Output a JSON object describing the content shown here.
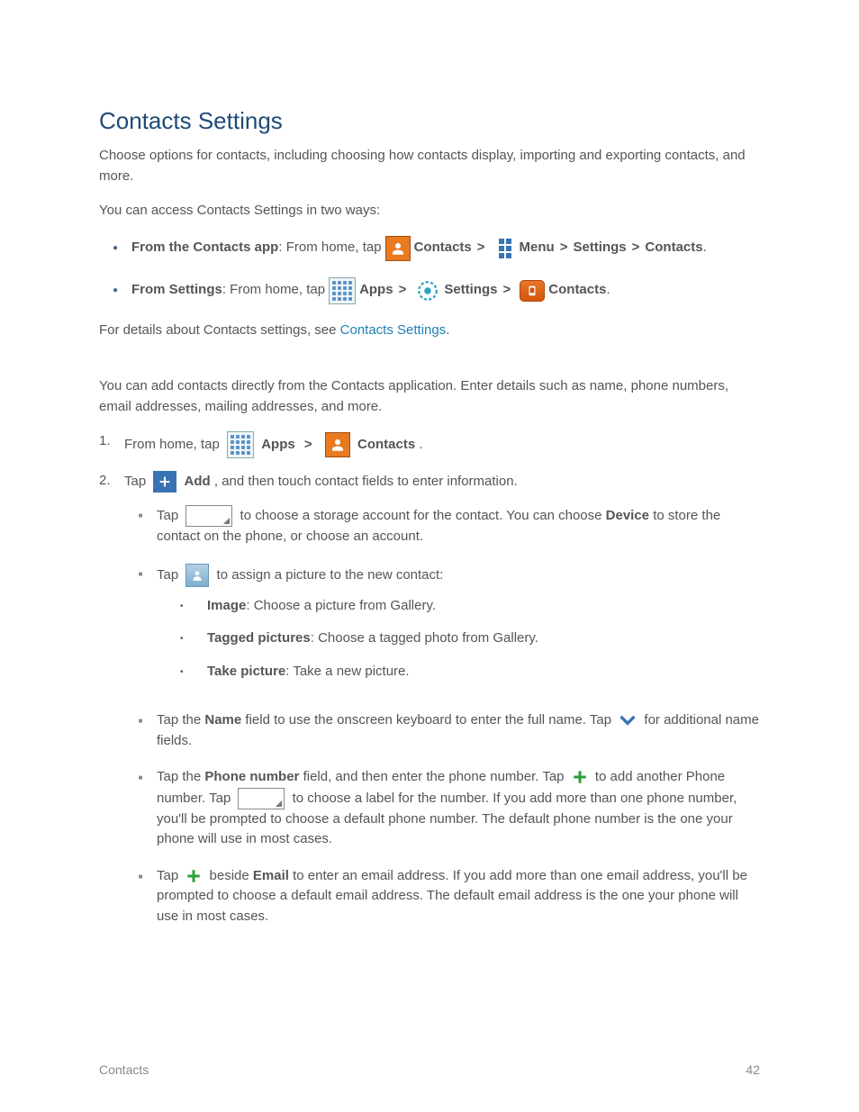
{
  "heading": "Contacts Settings",
  "intro": "Choose options for contacts, including choosing how contacts display, importing and exporting contacts, and more.",
  "access_intro": "You can access Contacts Settings in two ways:",
  "route1": {
    "prefix_bold": "From the Contacts app",
    "from_home_tap": ": From home, tap ",
    "contacts_label": "Contacts",
    "menu_label": "Menu",
    "settings_label": "Settings",
    "contacts_word": "Contacts"
  },
  "route2": {
    "prefix_bold": "From Settings",
    "from_home_tap": ": From home, tap ",
    "apps_label": "Apps",
    "settings_label": "Settings",
    "contacts_label": "Contacts"
  },
  "details_prefix": "For details about Contacts settings, see ",
  "details_link": "Contacts Settings",
  "details_suffix": ".",
  "add_intro": "You can add contacts directly from the Contacts application. Enter details such as name, phone numbers, email addresses, mailing addresses, and more.",
  "step1": {
    "num": "1.",
    "text1": "From home, tap ",
    "apps_label": "Apps",
    "contacts_label": "Contacts"
  },
  "step2": {
    "num": "2.",
    "tap": "Tap ",
    "add_label": "Add",
    "rest": ", and then touch contact fields to enter information."
  },
  "storage": {
    "tap": "Tap ",
    "text": " to choose a storage account for the contact. You can choose ",
    "device_bold": "Device",
    "text2": " to store the contact on the phone, or choose an account."
  },
  "picture": {
    "tap": "Tap ",
    "text": " to assign a picture to the new contact:",
    "opt1_bold": "Image",
    "opt1_rest": ": Choose a picture from Gallery.",
    "opt2_bold": "Tagged pictures",
    "opt2_rest": ": Choose a tagged photo from Gallery.",
    "opt3_bold": "Take picture",
    "opt3_rest": ": Take a new picture."
  },
  "name_field": {
    "tap_the": "Tap the ",
    "bold": "Name",
    "mid": " field to use the onscreen keyboard to enter the full name. Tap ",
    "after": " for additional name fields."
  },
  "phone_field": {
    "tap_the": "Tap the ",
    "bold": "Phone number",
    "mid": " field, and then enter the phone number. Tap ",
    "after1": " to add another Phone number. Tap ",
    "after2": " to choose a label for the number. If you add more than one phone number, you'll be prompted to choose a default phone number. The default phone number is the one your phone will use in most cases."
  },
  "email_field": {
    "tap": "Tap ",
    "beside": " beside ",
    "bold": "Email",
    "rest": " to enter an email address. If you add more than one email address, you'll be prompted to choose a default email address. The default email address is the one your phone will use in most cases."
  },
  "footer_left": "Contacts",
  "footer_right": "42"
}
